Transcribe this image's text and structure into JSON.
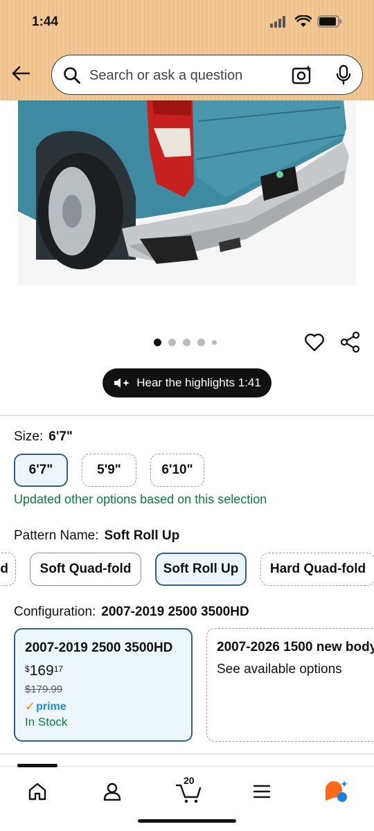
{
  "status_bar": {
    "time": "1:44"
  },
  "search": {
    "placeholder": "Search or ask a question"
  },
  "gallery": {
    "dot_count": 5,
    "active_index": 0
  },
  "highlights": {
    "label": "Hear the highlights 1:41"
  },
  "size": {
    "label": "Size:",
    "selected_value": "6'7\"",
    "options": [
      "6'7\"",
      "5'9\"",
      "6'10\""
    ],
    "note": "Updated other options based on this selection"
  },
  "pattern": {
    "label": "Pattern Name:",
    "selected_value": "Soft Roll Up",
    "options": [
      "d",
      "Soft Quad-fold",
      "Soft Roll Up",
      "Hard Quad-fold"
    ]
  },
  "configuration": {
    "label": "Configuration:",
    "selected_value": "2007-2019 2500 3500HD",
    "cards": [
      {
        "title": "2007-2019 2500 3500HD",
        "price_symbol": "$",
        "price_whole": "169",
        "price_fraction": "17",
        "list_price": "$179.99",
        "prime": "prime",
        "stock": "In Stock"
      },
      {
        "title": "2007-2026 1500 new body",
        "subtitle": "See available options"
      }
    ]
  },
  "bottom_nav": {
    "cart_count": "20"
  },
  "colors": {
    "header": "#f2c996",
    "selected_border": "#2e5f8f",
    "selected_bg": "#edf6fb",
    "success_green": "#067d3c",
    "prime_blue": "#1f8ce0"
  }
}
